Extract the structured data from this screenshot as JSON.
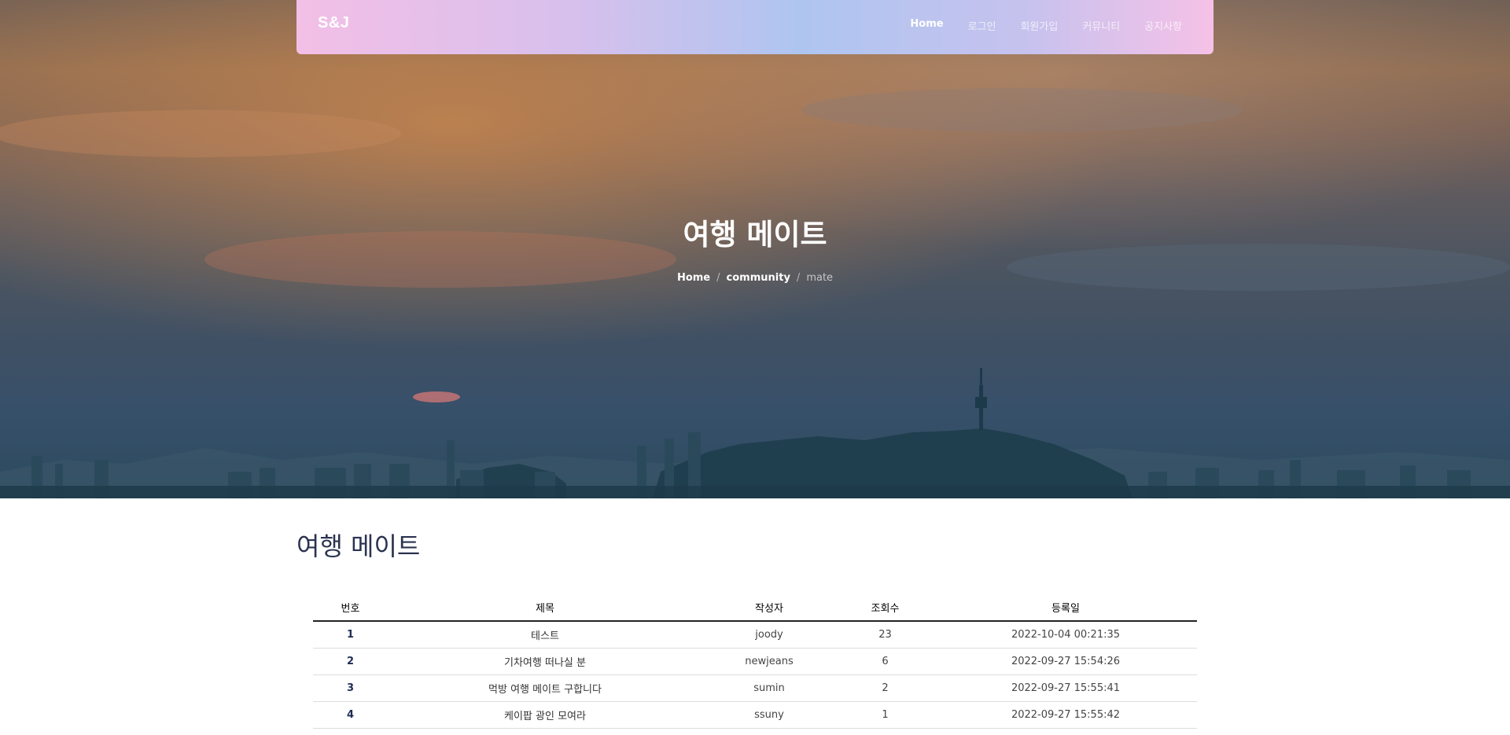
{
  "nav": {
    "brand": "S&J",
    "links": [
      "Home",
      "로그인",
      "회원가입",
      "커뮤니티",
      "공지사항"
    ]
  },
  "hero": {
    "title": "여행 메이트",
    "breadcrumb": [
      "Home",
      "community",
      "mate"
    ]
  },
  "page": {
    "heading": "여행 메이트"
  },
  "table": {
    "headers": [
      "번호",
      "제목",
      "작성자",
      "조회수",
      "등록일"
    ],
    "rows": [
      [
        "1",
        "테스트",
        "joody",
        "23",
        "2022-10-04 00:21:35"
      ],
      [
        "2",
        "기차여행 떠나실 분",
        "newjeans",
        "6",
        "2022-09-27 15:54:26"
      ],
      [
        "3",
        "먹방 여행 메이트 구합니다",
        "sumin",
        "2",
        "2022-09-27 15:55:41"
      ],
      [
        "4",
        "케이팝 광인 모여라",
        "ssuny",
        "1",
        "2022-09-27 15:55:42"
      ]
    ]
  },
  "colors": {
    "nav_gradient_start": "#f3bfe6",
    "nav_gradient_mid": "#aec5f0",
    "heading": "#2b3350",
    "row_number": "#1f2d55"
  },
  "icons": {
    "hero_background": "city-skyline-sunset-image"
  }
}
